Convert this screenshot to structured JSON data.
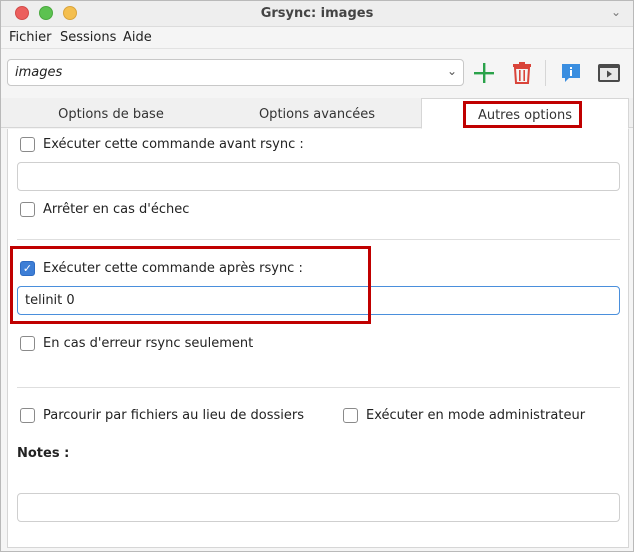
{
  "window": {
    "title": "Grsync: images"
  },
  "menu": [
    "Fichier",
    "Sessions",
    "Aide"
  ],
  "toolbar": {
    "session_value": "images",
    "add_color": "#2aa24a",
    "delete_color": "#d9443a",
    "info_color": "#3a8ee0"
  },
  "tabs": [
    {
      "label": "Options de base"
    },
    {
      "label": "Options avancées"
    },
    {
      "label": "Autres options"
    }
  ],
  "options": {
    "before_cmd_label": "Exécuter cette commande avant rsync :",
    "before_cmd_value": "",
    "stop_on_fail_label": "Arrêter en cas d'échec",
    "after_cmd_label": "Exécuter cette commande après rsync :",
    "after_cmd_value": "telinit 0",
    "rsync_error_only_label": "En cas d'erreur rsync seulement",
    "browse_files_label": "Parcourir par fichiers au lieu de dossiers",
    "run_as_admin_label": "Exécuter en mode administrateur",
    "notes_label": "Notes :",
    "notes_value": ""
  },
  "state": {
    "before_cmd_checked": false,
    "stop_on_fail_checked": false,
    "after_cmd_checked": true,
    "rsync_error_only_checked": false,
    "browse_files_checked": false,
    "run_as_admin_checked": false,
    "active_tab": "Autres options"
  },
  "colors": {
    "highlight": "#c00000",
    "checkbox_checked": "#3d7ed6"
  }
}
